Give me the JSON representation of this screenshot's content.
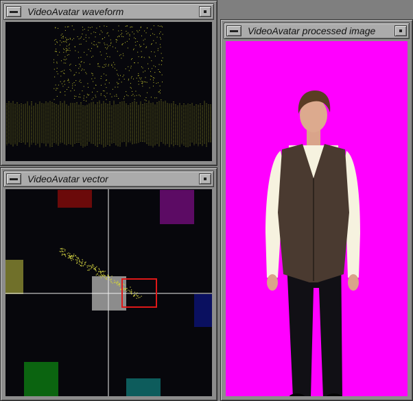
{
  "windows": {
    "waveform": {
      "title": "VideoAvatar waveform"
    },
    "vector": {
      "title": "VideoAvatar vector"
    },
    "image": {
      "title": "VideoAvatar processed image"
    }
  },
  "icons": {
    "window_menu": "window-menu-icon",
    "minimize": "minimize-icon"
  },
  "colors": {
    "waveform_trace": "#c8c832",
    "vector_trace": "#d0d040",
    "chroma_key_background": "#ff00ff",
    "vector_target_box": "#e01818",
    "crosshair": "#f0f0f0",
    "target_red": "#6b0a0a",
    "target_magenta": "#5c0b64",
    "target_yellow": "#70702a",
    "target_blue": "#0a1060",
    "target_green": "#0b6410",
    "target_cyan": "#0d5c5c",
    "center_patch": "#8c8c8c"
  }
}
